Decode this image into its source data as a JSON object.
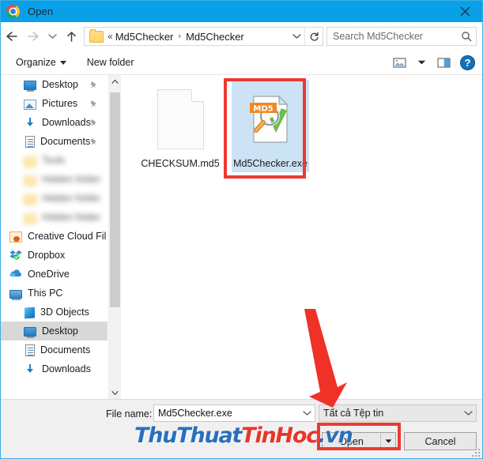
{
  "window": {
    "title": "Open",
    "app_icon": "chrome-logo-icon",
    "close_label": "✕",
    "titlebar_color": "#0aa0e8"
  },
  "navigation": {
    "back_icon": "back-arrow-icon",
    "forward_icon": "forward-arrow-icon",
    "recent_icon": "chevron-down-icon",
    "up_icon": "up-arrow-icon",
    "address": {
      "folder_icon": "folder-icon",
      "overflow": "«",
      "crumbs": [
        "Md5Checker",
        "Md5Checker"
      ],
      "separator": "›",
      "dropdown_icon": "chevron-down-icon",
      "refresh_icon": "refresh-icon"
    },
    "search": {
      "placeholder": "Search Md5Checker",
      "value": "",
      "icon": "search-icon"
    }
  },
  "command_bar": {
    "organize_label": "Organize",
    "new_folder_label": "New folder",
    "view_icon": "change-view-icon",
    "view_dropdown_icon": "chevron-down-icon",
    "preview_pane_icon": "preview-pane-icon",
    "help_label": "?",
    "help_icon": "help-icon"
  },
  "sidebar": {
    "items": [
      {
        "label": "Desktop",
        "icon": "desktop-icon",
        "pinned": true,
        "indent": "child",
        "blurred": false,
        "selected": false
      },
      {
        "label": "Pictures",
        "icon": "pictures-icon",
        "pinned": true,
        "indent": "child",
        "blurred": false,
        "selected": false
      },
      {
        "label": "Downloads",
        "icon": "downloads-icon",
        "pinned": true,
        "indent": "child",
        "blurred": false,
        "selected": false
      },
      {
        "label": "Documents",
        "icon": "documents-icon",
        "pinned": true,
        "indent": "child",
        "blurred": false,
        "selected": false
      },
      {
        "label": "Tools",
        "icon": "folder-icon",
        "pinned": false,
        "indent": "child",
        "blurred": true,
        "selected": false
      },
      {
        "label": "Hidden folder",
        "icon": "folder-icon",
        "pinned": false,
        "indent": "child",
        "blurred": true,
        "selected": false
      },
      {
        "label": "Hidden folder",
        "icon": "folder-icon",
        "pinned": false,
        "indent": "child",
        "blurred": true,
        "selected": false
      },
      {
        "label": "Hidden folder",
        "icon": "folder-icon",
        "pinned": false,
        "indent": "child",
        "blurred": true,
        "selected": false
      },
      {
        "label": "Creative Cloud Fil",
        "icon": "creative-cloud-icon",
        "pinned": false,
        "indent": "root",
        "blurred": false,
        "selected": false
      },
      {
        "label": "Dropbox",
        "icon": "dropbox-icon",
        "pinned": false,
        "indent": "root",
        "blurred": false,
        "selected": false
      },
      {
        "label": "OneDrive",
        "icon": "onedrive-icon",
        "pinned": false,
        "indent": "root",
        "blurred": false,
        "selected": false
      },
      {
        "label": "This PC",
        "icon": "this-pc-icon",
        "pinned": false,
        "indent": "root",
        "blurred": false,
        "selected": false
      },
      {
        "label": "3D Objects",
        "icon": "3d-objects-icon",
        "pinned": false,
        "indent": "child",
        "blurred": false,
        "selected": false
      },
      {
        "label": "Desktop",
        "icon": "desktop-icon",
        "pinned": false,
        "indent": "child",
        "blurred": false,
        "selected": true
      },
      {
        "label": "Documents",
        "icon": "documents-icon",
        "pinned": false,
        "indent": "child",
        "blurred": false,
        "selected": false
      },
      {
        "label": "Downloads",
        "icon": "downloads-icon",
        "pinned": false,
        "indent": "child",
        "blurred": false,
        "selected": false
      }
    ],
    "scroll_up_icon": "chevron-up-icon",
    "scroll_down_icon": "chevron-down-icon"
  },
  "files": [
    {
      "name": "CHECKSUM.md5",
      "icon": "blank-document-icon",
      "selected": false
    },
    {
      "name": "Md5Checker.exe",
      "icon": "md5checker-app-icon",
      "selected": true
    }
  ],
  "footer": {
    "filename_label": "File name:",
    "filename_value": "Md5Checker.exe",
    "filename_placeholder": "File name",
    "filename_dropdown_icon": "chevron-down-icon",
    "filter_value": "Tất cả Tệp tin",
    "filter_dropdown_icon": "chevron-down-icon",
    "open_label": "Open",
    "open_split_icon": "triangle-down-icon",
    "cancel_label": "Cancel",
    "resize_grip_icon": "resize-grip-icon"
  },
  "watermark": {
    "part1": "ThuThuat",
    "part2": "TinHoc",
    "part3": ".vn",
    "color_blue": "#2a6fbd",
    "color_red": "#e8352b"
  },
  "annotations": {
    "highlight_color": "#ec3a32",
    "file_box_target": "Md5Checker.exe",
    "open_box_target": "Open",
    "arrow_icon": "red-arrow-icon"
  }
}
